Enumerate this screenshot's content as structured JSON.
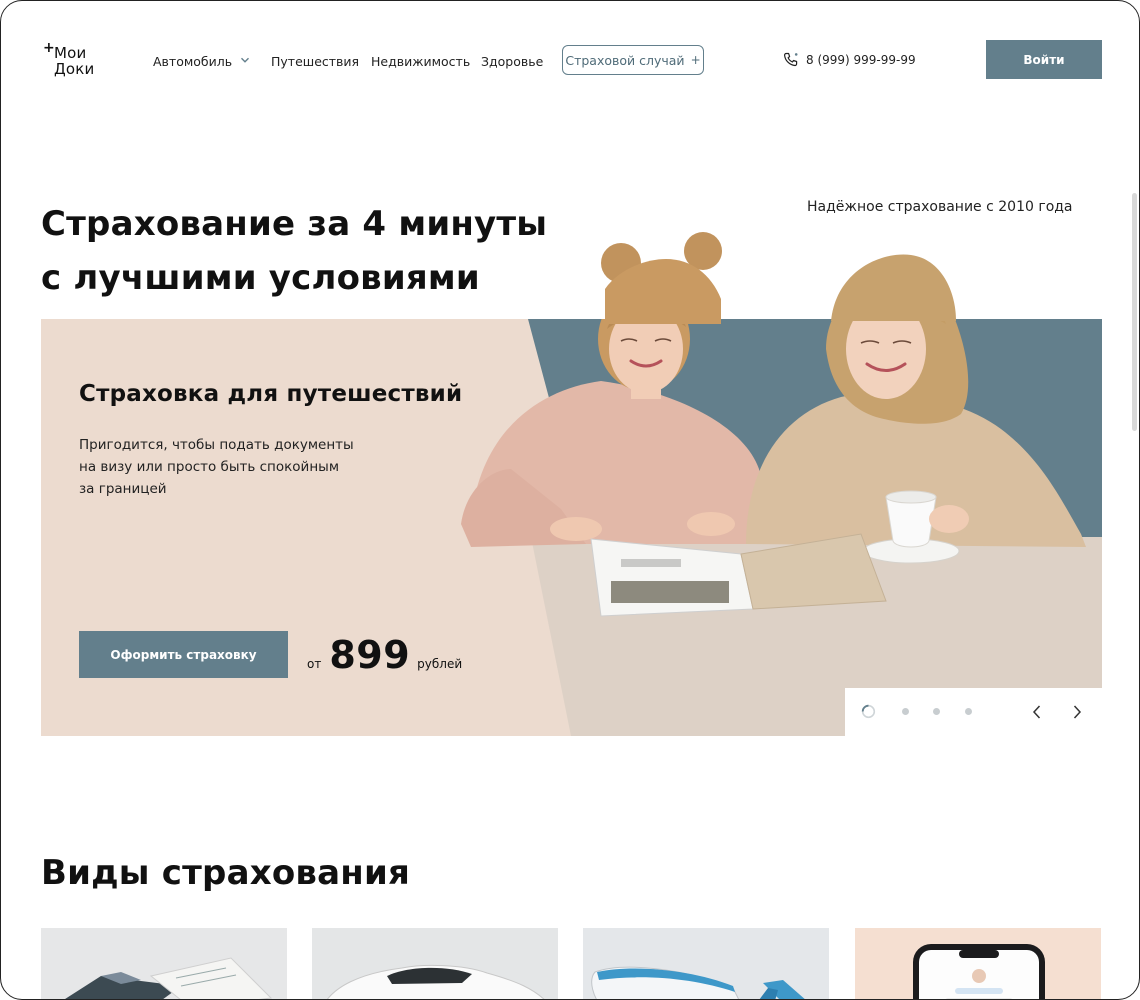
{
  "header": {
    "logo_line1": "Мои",
    "logo_line2": "Доки",
    "logo_plus": "+",
    "nav": [
      {
        "label": "Автомобиль",
        "has_dropdown": true
      },
      {
        "label": "Путешествия"
      },
      {
        "label": "Недвижимость"
      },
      {
        "label": "Здоровье"
      }
    ],
    "claim_button": "Страховой случай",
    "claim_plus": "+",
    "phone": "8 (999) 999-99-99",
    "login_button": "Войти",
    "icons": {
      "phone": "phone-icon",
      "dropdown": "chevron-down-icon",
      "plus": "plus-icon"
    }
  },
  "hero": {
    "title_line1": "Страхование за 4 минуты",
    "title_line2": "с лучшими условиями",
    "trust_text": "Надёжное страхование с 2010 года"
  },
  "banner": {
    "title": "Страховка для путешествий",
    "desc_line1": "Пригодится, чтобы подать документы",
    "desc_line2": "на визу или просто быть спокойным",
    "desc_line3": "за границей",
    "button": "Оформить страховку",
    "price_from": "от",
    "price_value": "899",
    "price_currency": "рублей",
    "photo_subject": "two-young-women-reading-magazine",
    "slides_total": 4,
    "active_slide": 1,
    "icons": {
      "prev": "chevron-left-icon",
      "next": "chevron-right-icon"
    },
    "colors": {
      "peach": "#ecdbcf",
      "slate": "#637f8c",
      "table": "#ddd1c6"
    }
  },
  "insurance_types": {
    "title": "Виды страхования",
    "cards": [
      {
        "subject": "documents-and-tablet"
      },
      {
        "subject": "white-car"
      },
      {
        "subject": "airplane"
      },
      {
        "subject": "smartphone-chat"
      }
    ]
  },
  "colors": {
    "accent": "#637f8c",
    "text": "#111111"
  }
}
